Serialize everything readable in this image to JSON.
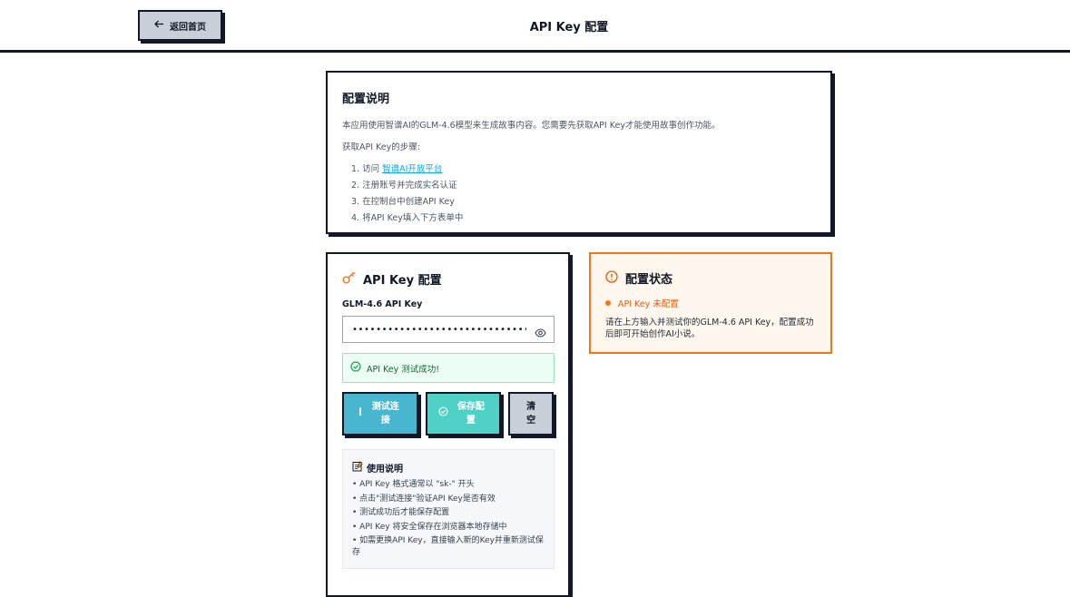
{
  "header": {
    "back_label": "返回首页",
    "title": "API Key 配置"
  },
  "info": {
    "title": "配置说明",
    "intro": "本应用使用智谱AI的GLM-4.6模型来生成故事内容。您需要先获取API Key才能使用故事创作功能。",
    "steps_title": "获取API Key的步骤:",
    "steps": [
      {
        "prefix": "1. 访问 ",
        "link": "智谱AI开放平台"
      },
      {
        "text": "2. 注册账号并完成实名认证"
      },
      {
        "text": "3. 在控制台中创建API Key"
      },
      {
        "text": "4. 将API Key填入下方表单中"
      }
    ]
  },
  "config": {
    "title": "API Key 配置",
    "field_label": "GLM-4.6 API Key",
    "key_value": "••••••••••••••••••••••••••••••••••••",
    "success_text": "API Key 测试成功!",
    "buttons": {
      "test": "测试连接",
      "save": "保存配置",
      "clear": "清空"
    },
    "usage": {
      "title": "使用说明",
      "items": [
        "• API Key 格式通常以 \"sk-\" 开头",
        "• 点击\"测试连接\"验证API Key是否有效",
        "• 测试成功后才能保存配置",
        "• API Key 将安全保存在浏览器本地存储中",
        "• 如需更换API Key，直接输入新的Key并重新测试保存"
      ]
    }
  },
  "status": {
    "title": "配置状态",
    "state": "API Key 未配置",
    "desc": "请在上方输入并测试你的GLM-4.6 API Key，配置成功后即可开始创作AI小说。"
  },
  "colors": {
    "accent_orange": "#f97316",
    "test_button": "#49b6cf",
    "save_button": "#4fd1c5",
    "success_green": "#166534"
  }
}
